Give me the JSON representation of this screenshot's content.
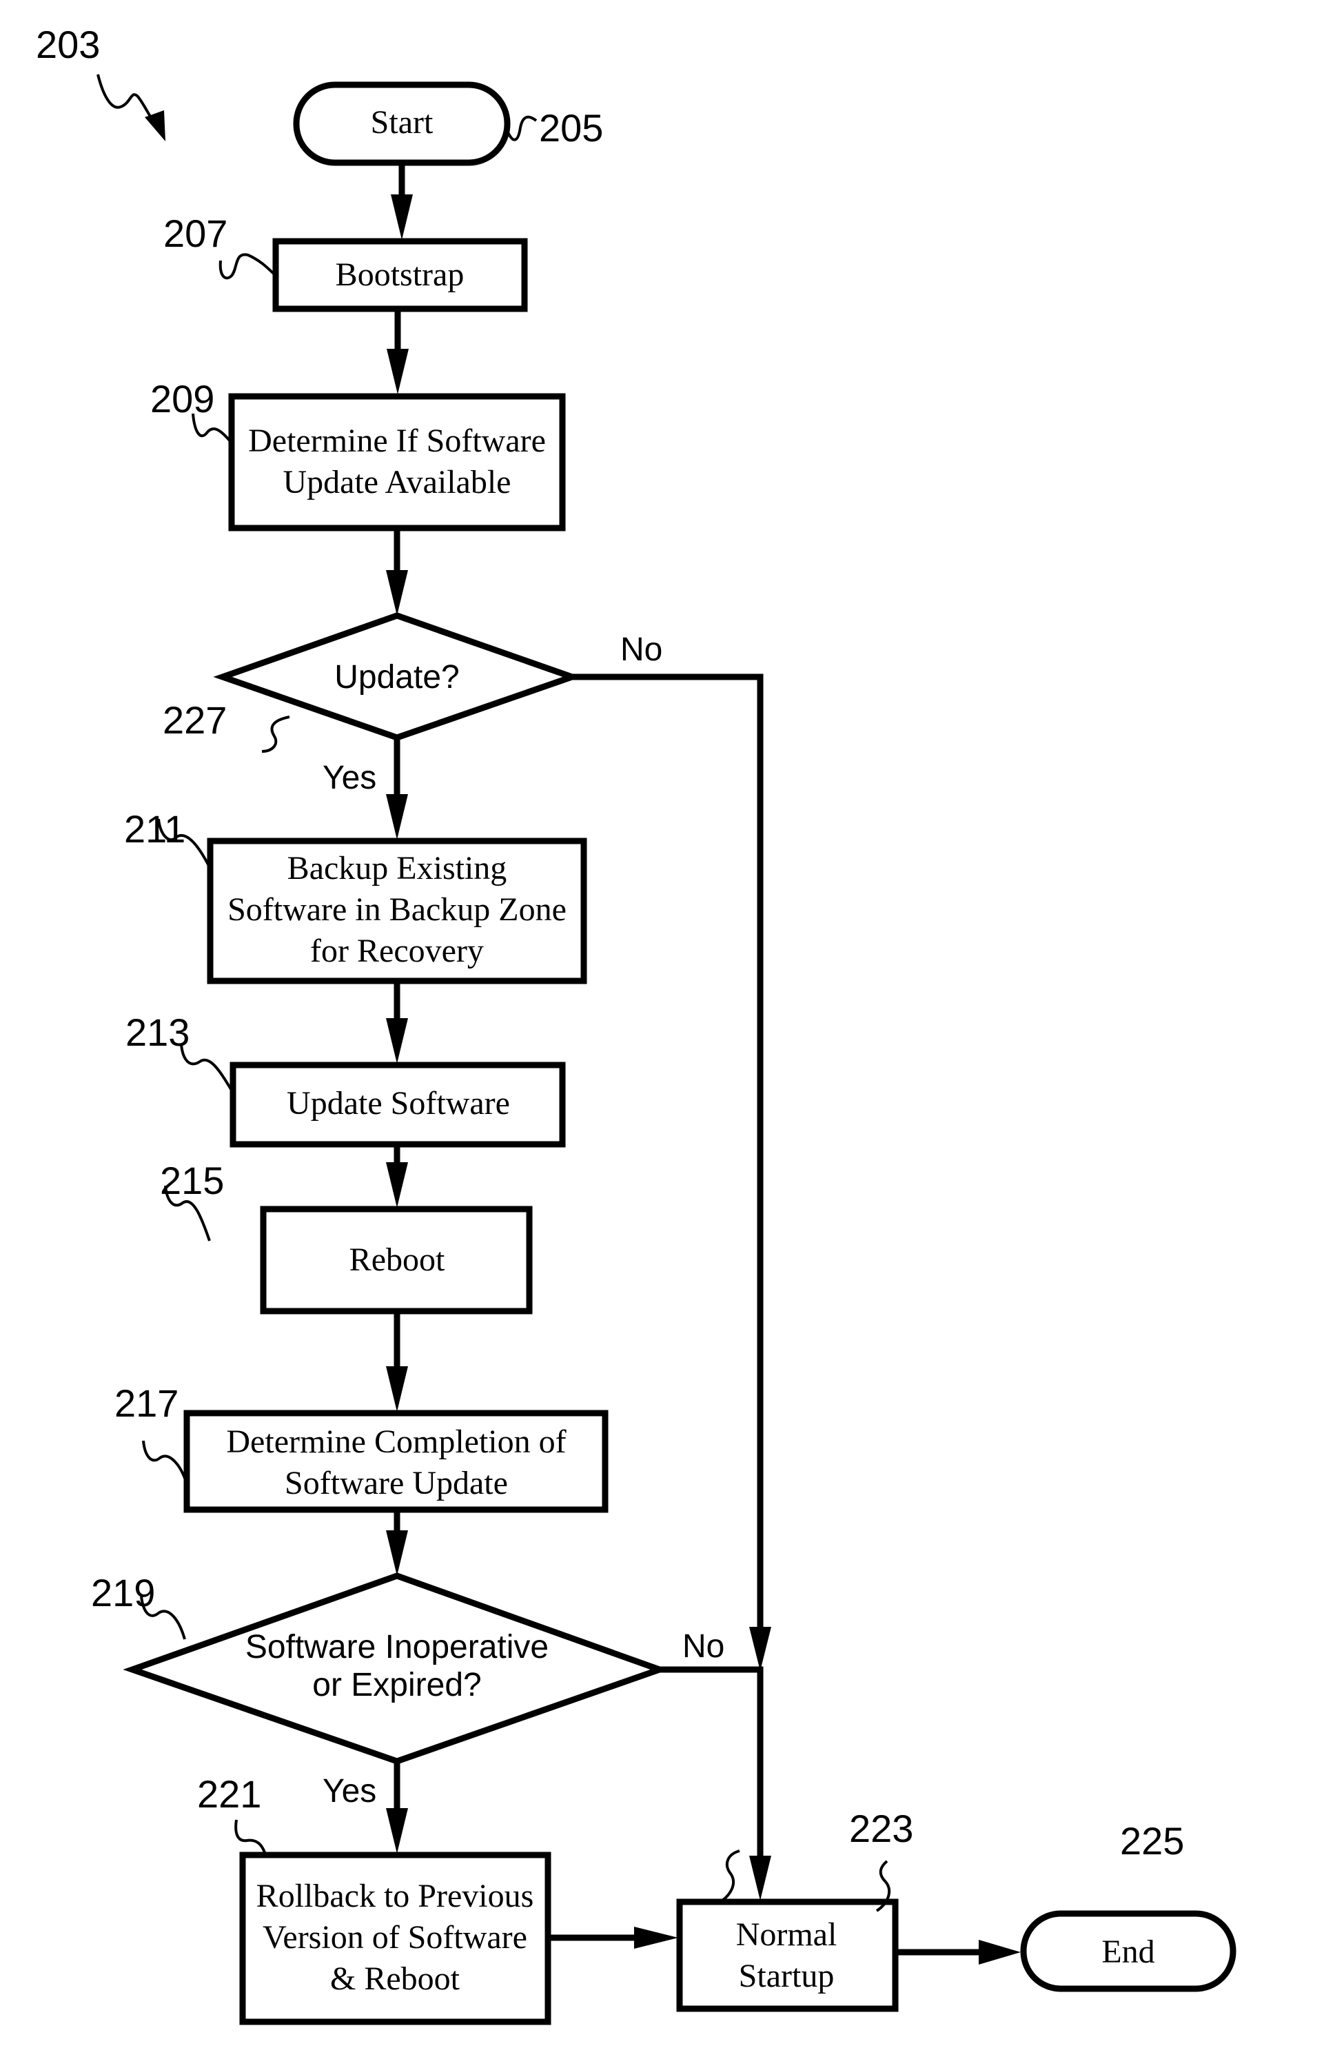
{
  "figure": {
    "reference": "203",
    "nodes": [
      {
        "id": "start",
        "ref": "205",
        "type": "terminator",
        "lines": [
          "Start"
        ]
      },
      {
        "id": "bootstrap",
        "ref": "207",
        "type": "process",
        "lines": [
          "Bootstrap"
        ]
      },
      {
        "id": "determine-update",
        "ref": "209",
        "type": "process",
        "lines": [
          "Determine If Software",
          "Update Available"
        ]
      },
      {
        "id": "update-decision",
        "ref": "227",
        "type": "decision",
        "lines": [
          "Update?"
        ]
      },
      {
        "id": "backup",
        "ref": "211",
        "type": "process",
        "lines": [
          "Backup Existing",
          "Software in Backup Zone",
          "for Recovery"
        ]
      },
      {
        "id": "update-software",
        "ref": "213",
        "type": "process",
        "lines": [
          "Update Software"
        ]
      },
      {
        "id": "reboot",
        "ref": "215",
        "type": "process",
        "lines": [
          "Reboot"
        ]
      },
      {
        "id": "determine-completion",
        "ref": "217",
        "type": "process",
        "lines": [
          "Determine Completion of",
          "Software Update"
        ]
      },
      {
        "id": "inoperative-decision",
        "ref": "219",
        "type": "decision",
        "lines": [
          "Software Inoperative",
          "or Expired?"
        ]
      },
      {
        "id": "rollback",
        "ref": "221",
        "type": "process",
        "lines": [
          "Rollback to Previous",
          "Version of Software",
          "& Reboot"
        ]
      },
      {
        "id": "normal-startup",
        "ref": "223",
        "type": "process",
        "lines": [
          "Normal",
          "Startup"
        ]
      },
      {
        "id": "end",
        "ref": "225",
        "type": "terminator",
        "lines": [
          "End"
        ]
      }
    ],
    "edges": [
      {
        "from": "start",
        "to": "bootstrap",
        "label": ""
      },
      {
        "from": "bootstrap",
        "to": "determine-update",
        "label": ""
      },
      {
        "from": "determine-update",
        "to": "update-decision",
        "label": ""
      },
      {
        "from": "update-decision",
        "to": "backup",
        "label": "Yes"
      },
      {
        "from": "update-decision",
        "to": "normal-startup",
        "label": "No"
      },
      {
        "from": "backup",
        "to": "update-software",
        "label": ""
      },
      {
        "from": "update-software",
        "to": "reboot",
        "label": ""
      },
      {
        "from": "reboot",
        "to": "determine-completion",
        "label": ""
      },
      {
        "from": "determine-completion",
        "to": "inoperative-decision",
        "label": ""
      },
      {
        "from": "inoperative-decision",
        "to": "rollback",
        "label": "Yes"
      },
      {
        "from": "inoperative-decision",
        "to": "normal-startup",
        "label": "No"
      },
      {
        "from": "rollback",
        "to": "normal-startup",
        "label": ""
      },
      {
        "from": "normal-startup",
        "to": "end",
        "label": ""
      }
    ]
  }
}
